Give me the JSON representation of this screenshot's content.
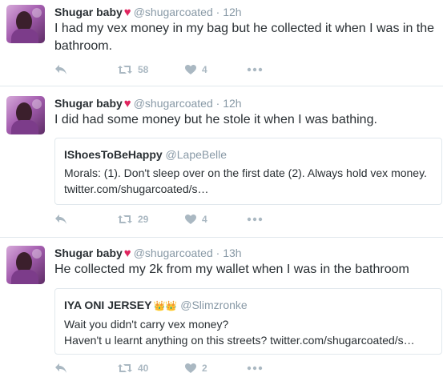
{
  "tweets": [
    {
      "name": "Shugar baby",
      "heart": "♥",
      "handle": "@shugarcoated",
      "dot": "·",
      "time": "12h",
      "text": "I had my vex money in my bag but he collected it when I was in the bathroom.",
      "retweets": "58",
      "likes": "4"
    },
    {
      "name": "Shugar baby",
      "heart": "♥",
      "handle": "@shugarcoated",
      "dot": "·",
      "time": "12h",
      "text": "I did had some money but he stole it when I was bathing.",
      "quote": {
        "name": "IShoesToBeHappy",
        "handle": "@LapeBelle",
        "line1": "Morals: (1). Don't sleep over on the first date  (2). Always hold vex money.",
        "line2": "twitter.com/shugarcoated/s…"
      },
      "retweets": "29",
      "likes": "4"
    },
    {
      "name": "Shugar baby",
      "heart": "♥",
      "handle": "@shugarcoated",
      "dot": "·",
      "time": "13h",
      "text": "He collected my 2k from my wallet when I was in the bathroom",
      "quote": {
        "name": "IYA ONI JERSEY",
        "emoji": "👑👑",
        "handle": "@Slimzronke",
        "line1": "Wait you didn't carry vex money?",
        "line2": "Haven't u learnt anything on this streets? twitter.com/shugarcoated/s…"
      },
      "retweets": "40",
      "likes": "2"
    }
  ],
  "colors": {
    "accent_heart": "#e0245e",
    "muted": "#8899a6",
    "action_gray": "#aab8c2",
    "border": "#e1e8ed"
  },
  "icons": [
    "reply-icon",
    "retweet-icon",
    "like-icon",
    "more-icon"
  ]
}
